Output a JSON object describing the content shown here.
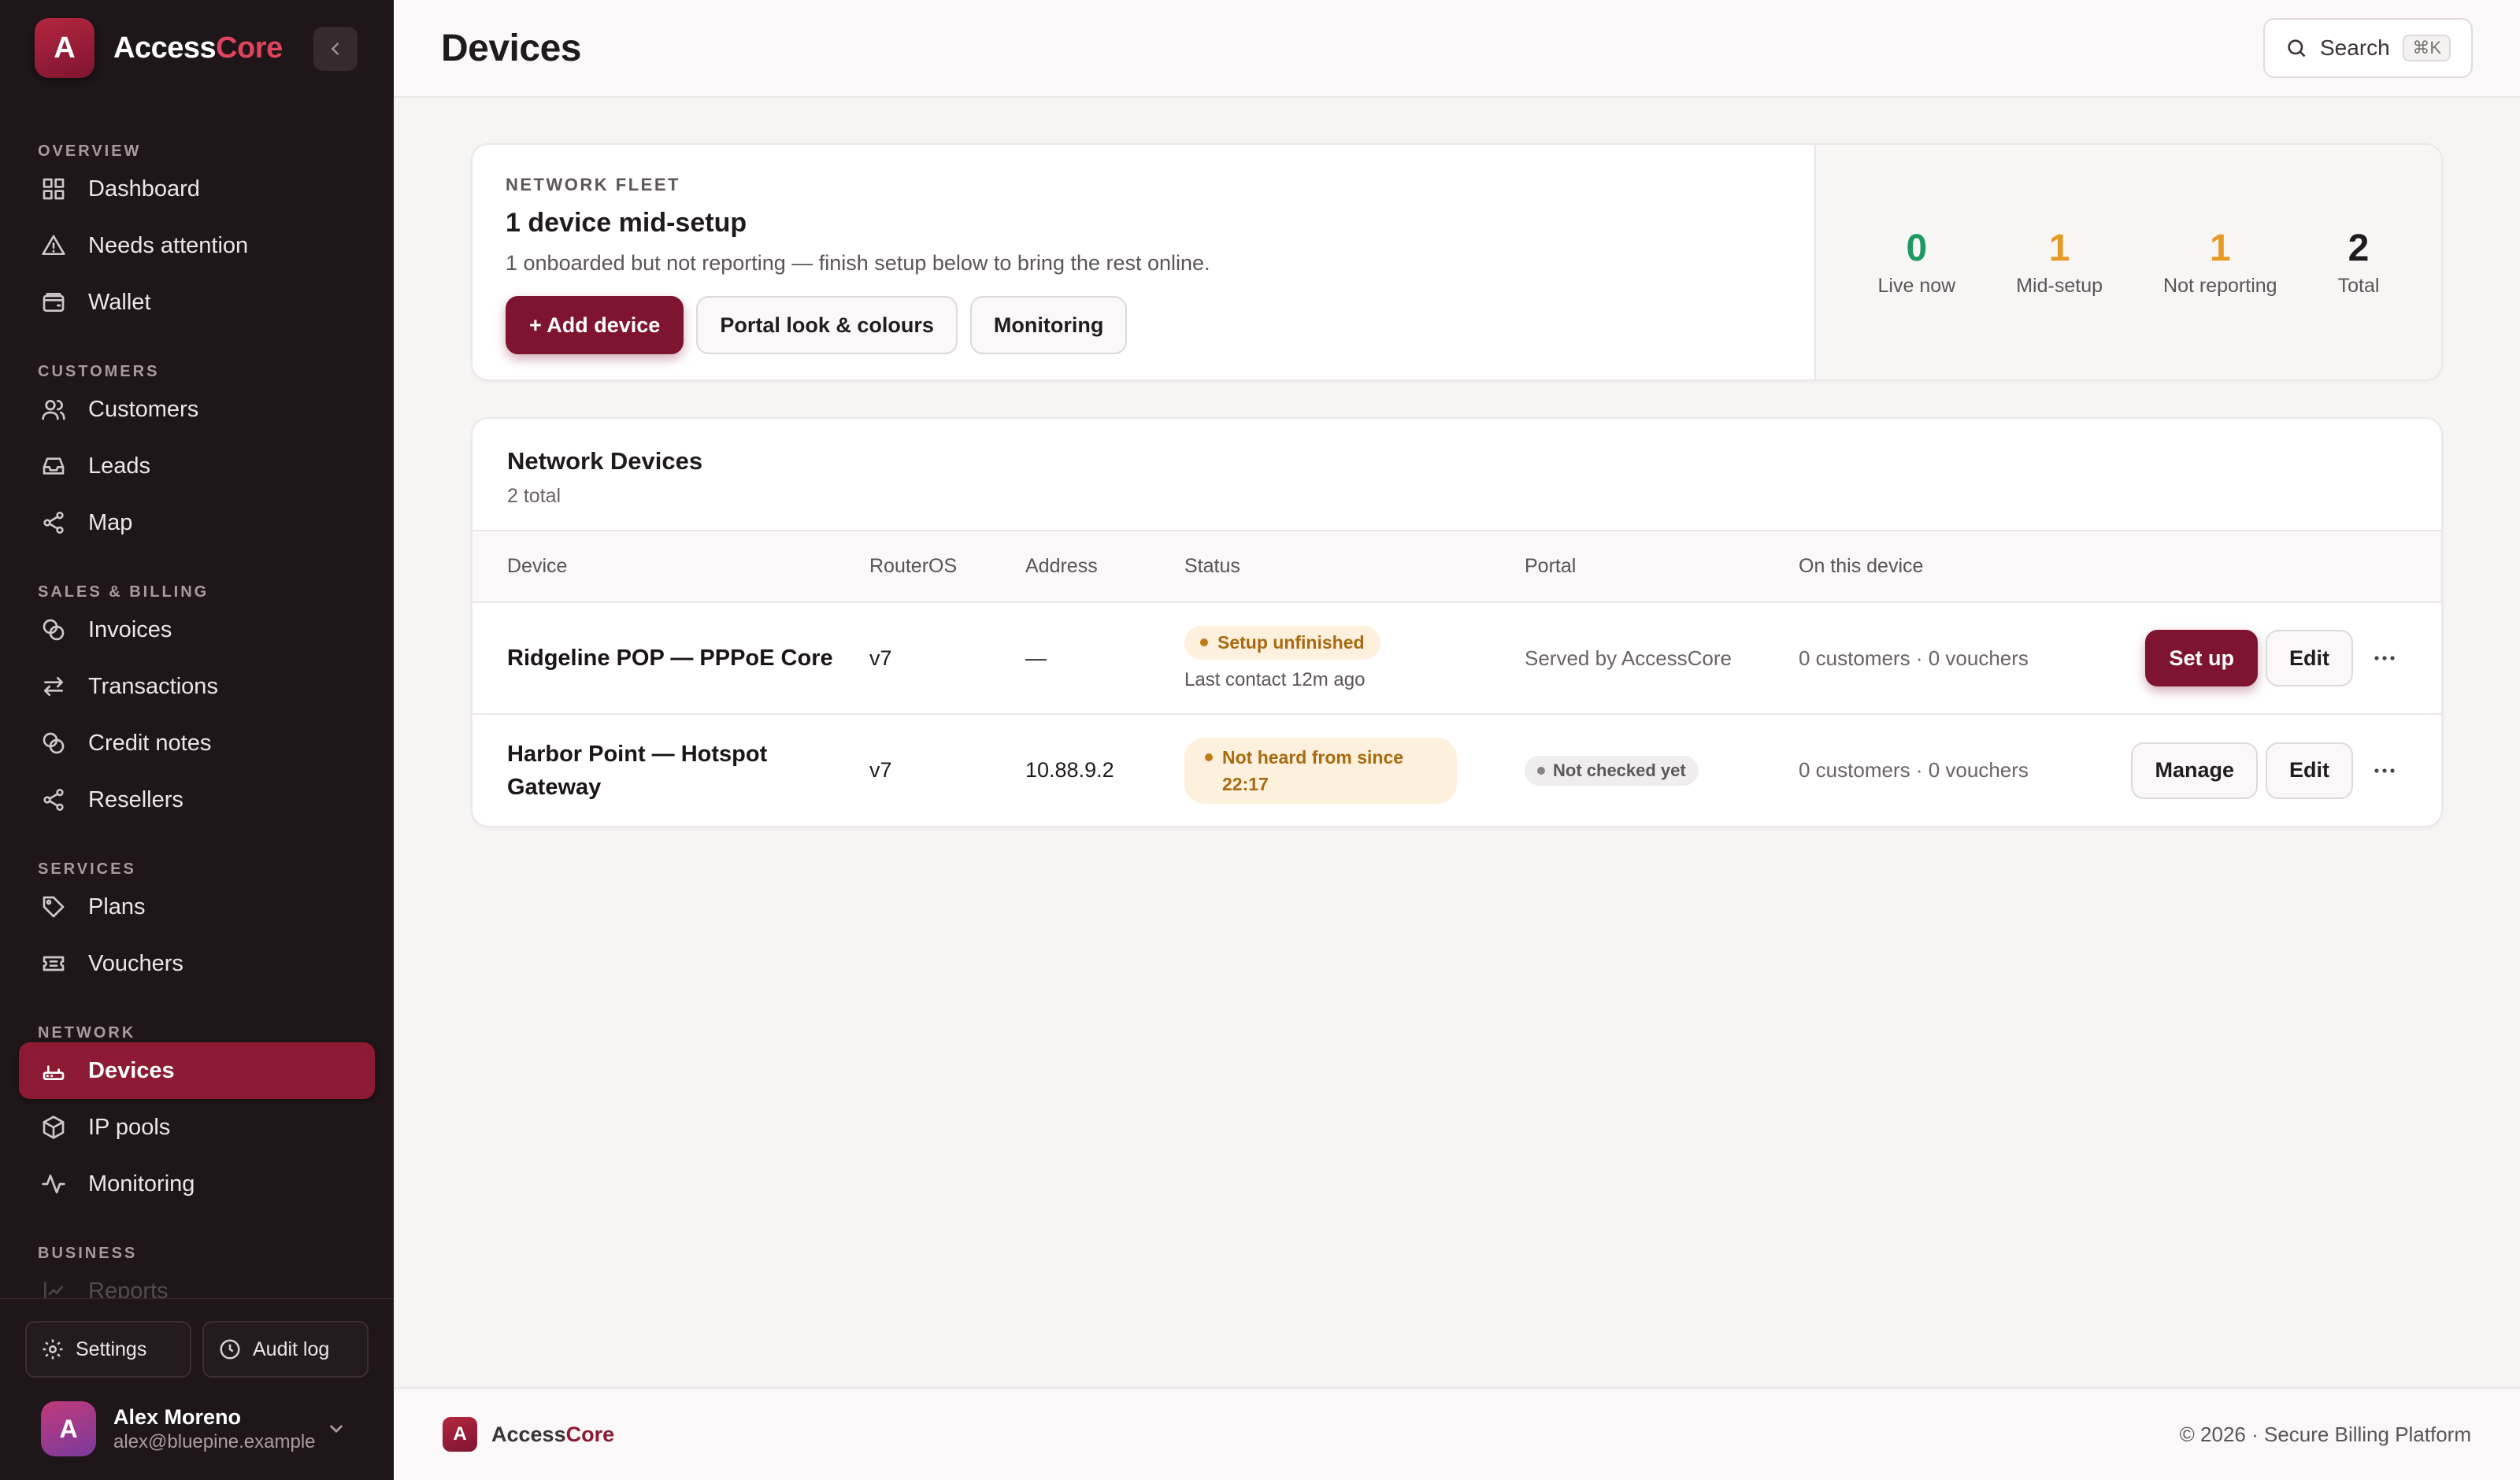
{
  "brand": {
    "name_a": "Access",
    "name_b": "Core",
    "logo_letter": "A"
  },
  "nav": {
    "sections": [
      {
        "title": "OVERVIEW",
        "items": [
          {
            "label": "Dashboard",
            "icon": "dashboard-icon"
          },
          {
            "label": "Needs attention",
            "icon": "alert-icon"
          },
          {
            "label": "Wallet",
            "icon": "wallet-icon"
          }
        ]
      },
      {
        "title": "CUSTOMERS",
        "items": [
          {
            "label": "Customers",
            "icon": "users-icon"
          },
          {
            "label": "Leads",
            "icon": "inbox-icon"
          },
          {
            "label": "Map",
            "icon": "share-icon"
          }
        ]
      },
      {
        "title": "SALES & BILLING",
        "items": [
          {
            "label": "Invoices",
            "icon": "coins-icon"
          },
          {
            "label": "Transactions",
            "icon": "swap-icon"
          },
          {
            "label": "Credit notes",
            "icon": "coins-icon"
          },
          {
            "label": "Resellers",
            "icon": "share-icon"
          }
        ]
      },
      {
        "title": "SERVICES",
        "items": [
          {
            "label": "Plans",
            "icon": "tag-icon"
          },
          {
            "label": "Vouchers",
            "icon": "ticket-icon"
          }
        ]
      },
      {
        "title": "NETWORK",
        "items": [
          {
            "label": "Devices",
            "icon": "router-icon",
            "active": true
          },
          {
            "label": "IP pools",
            "icon": "box-icon"
          },
          {
            "label": "Monitoring",
            "icon": "pulse-icon"
          }
        ]
      },
      {
        "title": "BUSINESS",
        "items": [
          {
            "label": "Reports",
            "icon": "chart-icon"
          }
        ]
      }
    ],
    "settings_label": "Settings",
    "audit_label": "Audit log"
  },
  "user": {
    "initial": "A",
    "name": "Alex Moreno",
    "email": "alex@bluepine.example"
  },
  "header": {
    "title": "Devices",
    "search_label": "Search",
    "search_kbd": "⌘K"
  },
  "fleet": {
    "eyebrow": "NETWORK FLEET",
    "title": "1 device mid-setup",
    "description": "1 onboarded but not reporting — finish setup below to bring the rest online.",
    "add_label": "+ Add device",
    "portal_label": "Portal look & colours",
    "monitoring_label": "Monitoring",
    "stats": [
      {
        "value": "0",
        "label": "Live now",
        "color": "#1d9a5f"
      },
      {
        "value": "1",
        "label": "Mid-setup",
        "color": "#e59a24"
      },
      {
        "value": "1",
        "label": "Not reporting",
        "color": "#e59a24"
      },
      {
        "value": "2",
        "label": "Total",
        "color": "#1f1a1b"
      }
    ]
  },
  "devices": {
    "title": "Network Devices",
    "subtitle": "2 total",
    "columns": [
      "Device",
      "RouterOS",
      "Address",
      "Status",
      "Portal",
      "On this device"
    ],
    "rows": [
      {
        "name": "Ridgeline POP — PPPoE Core",
        "routeros": "v7",
        "address": "—",
        "status": "Setup unfinished",
        "last_contact": "Last contact 12m ago",
        "portal": "Served by AccessCore",
        "usage": "0 customers · 0 vouchers",
        "primary_action": "Set up",
        "edit": "Edit"
      },
      {
        "name": "Harbor Point — Hotspot Gateway",
        "routeros": "v7",
        "address": "10.88.9.2",
        "status": "Not heard from since 22:17",
        "portal": "Not checked yet",
        "usage": "0 customers · 0 vouchers",
        "primary_action": "Manage",
        "edit": "Edit"
      }
    ]
  },
  "footer": {
    "brand_a": "Access",
    "brand_b": "Core",
    "logo_letter": "A",
    "copyright": "© 2026 · Secure Billing Platform"
  }
}
